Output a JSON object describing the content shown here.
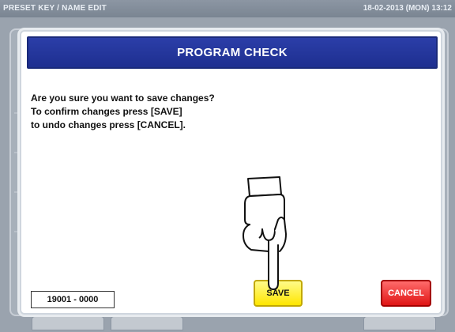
{
  "topbar": {
    "screen_title": "PRESET KEY / NAME EDIT",
    "datetime": "18-02-2013 (MON)  13:12"
  },
  "dialog": {
    "title": "PROGRAM CHECK",
    "message_lines": [
      "Are you sure you want to save changes?",
      "To confirm changes press [SAVE]",
      "to undo changes press [CANCEL]."
    ],
    "code": "19001 - 0000",
    "save_label": "SAVE",
    "cancel_label": "CANCEL"
  },
  "colors": {
    "header_blue": "#1e2f90",
    "save_yellow": "#ffe600",
    "cancel_red": "#e01515"
  },
  "icons": {
    "pointer": "hand-pointer-icon"
  }
}
